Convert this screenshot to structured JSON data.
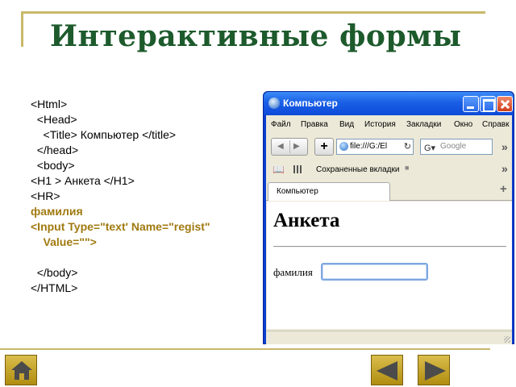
{
  "slide": {
    "title": "Интерактивные формы",
    "accent_color": "#1d5a2c",
    "gold_color": "#a07a10"
  },
  "code_lines": [
    "<Html>",
    "  <Head>",
    "    <Title> Компьютер </title>",
    "  </head>",
    "  <body>",
    "<H1 > Анкета </H1>",
    "<HR>",
    "фамилия",
    "<Input Type=\"text' Name=\"regist\"",
    "    Value=\"\">",
    "",
    "  </body>",
    "</HTML>"
  ],
  "browser": {
    "window_title": "Компьютер",
    "menu": [
      "Файл",
      "Правка",
      "Вид",
      "История",
      "Закладки",
      "Окно",
      "Справк"
    ],
    "url": "file:///G:/El",
    "search_placeholder": "Google",
    "bookmarks_label": "Сохраненные вкладки",
    "tab_label": "Компьютер",
    "page": {
      "heading": "Анкета",
      "field_label": "фамилия",
      "field_value": ""
    }
  },
  "icons": {
    "titlebar": "firefox-icon",
    "home": "home-icon",
    "prev": "arrow-left-icon",
    "next": "arrow-right-icon"
  }
}
